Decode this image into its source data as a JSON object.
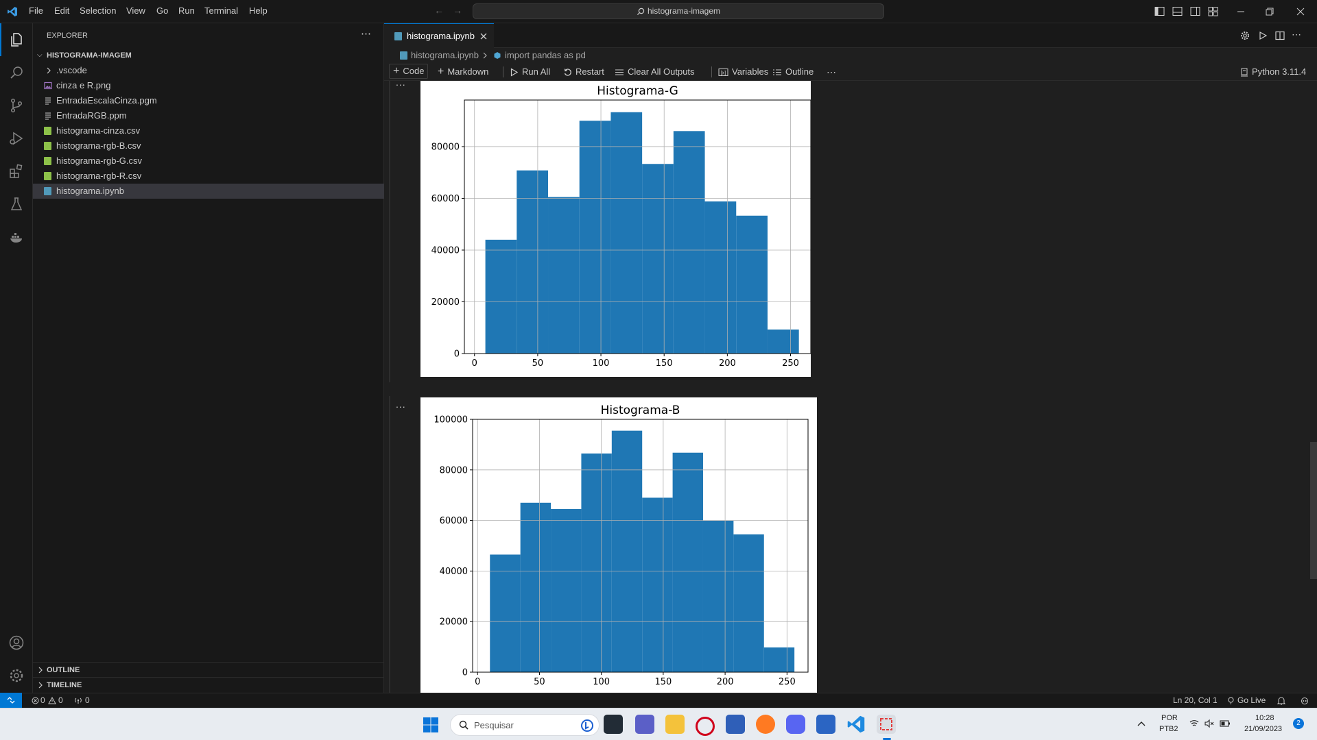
{
  "titlebar": {
    "menu": [
      "File",
      "Edit",
      "Selection",
      "View",
      "Go",
      "Run",
      "Terminal",
      "Help"
    ],
    "search_text": "histograma-imagem"
  },
  "sidebar": {
    "header": "EXPLORER",
    "root": "HISTOGRAMA-IMAGEM",
    "files": [
      {
        "name": ".vscode",
        "icon": "chevron-right-icon"
      },
      {
        "name": "cinza e R.png",
        "icon": "image-file-icon"
      },
      {
        "name": "EntradaEscalaCinza.pgm",
        "icon": "text-file-icon"
      },
      {
        "name": "EntradaRGB.ppm",
        "icon": "text-file-icon"
      },
      {
        "name": "histograma-cinza.csv",
        "icon": "csv-file-icon"
      },
      {
        "name": "histograma-rgb-B.csv",
        "icon": "csv-file-icon"
      },
      {
        "name": "histograma-rgb-G.csv",
        "icon": "csv-file-icon"
      },
      {
        "name": "histograma-rgb-R.csv",
        "icon": "csv-file-icon"
      },
      {
        "name": "histograma.ipynb",
        "icon": "notebook-file-icon"
      }
    ],
    "outline": "OUTLINE",
    "timeline": "TIMELINE"
  },
  "editor": {
    "tab_label": "histograma.ipynb",
    "breadcrumb_file": "histograma.ipynb",
    "breadcrumb_symbol": "import pandas as pd",
    "toolbar": {
      "code": "Code",
      "markdown": "Markdown",
      "run_all": "Run All",
      "restart": "Restart",
      "clear_outputs": "Clear All Outputs",
      "variables": "Variables",
      "outline": "Outline",
      "kernel": "Python 3.11.4"
    },
    "cell_more": "..."
  },
  "chart_data": [
    {
      "type": "bar",
      "title": "Histograma-G",
      "x_ticks": [
        0,
        50,
        100,
        150,
        200,
        250
      ],
      "y_ticks": [
        0,
        20000,
        40000,
        60000,
        80000
      ],
      "xlim": [
        -8,
        266
      ],
      "ylim": [
        0,
        98000
      ],
      "bins": [
        [
          8.6,
          33.4
        ],
        [
          33.4,
          58.2
        ],
        [
          58.2,
          83.0
        ],
        [
          83.0,
          107.8
        ],
        [
          107.8,
          132.6
        ],
        [
          132.6,
          157.4
        ],
        [
          157.4,
          182.2
        ],
        [
          182.2,
          207.0
        ],
        [
          207.0,
          231.8
        ],
        [
          231.8,
          256.6
        ]
      ],
      "values": [
        44000,
        70800,
        60500,
        90000,
        93300,
        73300,
        86000,
        58800,
        53300,
        9300
      ],
      "color": "#1f77b4",
      "grid": true
    },
    {
      "type": "bar",
      "title": "Histograma-B",
      "x_ticks": [
        0,
        50,
        100,
        150,
        200,
        250
      ],
      "y_ticks": [
        0,
        20000,
        40000,
        60000,
        80000,
        100000
      ],
      "xlim": [
        -4,
        267
      ],
      "ylim": [
        0,
        100000
      ],
      "bins": [
        [
          10,
          34.6
        ],
        [
          34.6,
          59.2
        ],
        [
          59.2,
          83.8
        ],
        [
          83.8,
          108.4
        ],
        [
          108.4,
          133.0
        ],
        [
          133.0,
          157.6
        ],
        [
          157.6,
          182.2
        ],
        [
          182.2,
          206.8
        ],
        [
          206.8,
          231.4
        ],
        [
          231.4,
          256
        ]
      ],
      "values": [
        46500,
        67000,
        64500,
        86500,
        95500,
        69000,
        86800,
        60000,
        54500,
        9800
      ],
      "color": "#1f77b4",
      "grid": true
    }
  ],
  "statusbar": {
    "errors": "0",
    "warnings": "0",
    "ports": "0",
    "cursor": "Ln 20, Col 1",
    "golive": "Go Live"
  },
  "taskbar": {
    "search_placeholder": "Pesquisar",
    "lang_top": "POR",
    "lang_bottom": "PTB2",
    "time": "10:28",
    "date": "21/09/2023",
    "notif_count": "2"
  }
}
